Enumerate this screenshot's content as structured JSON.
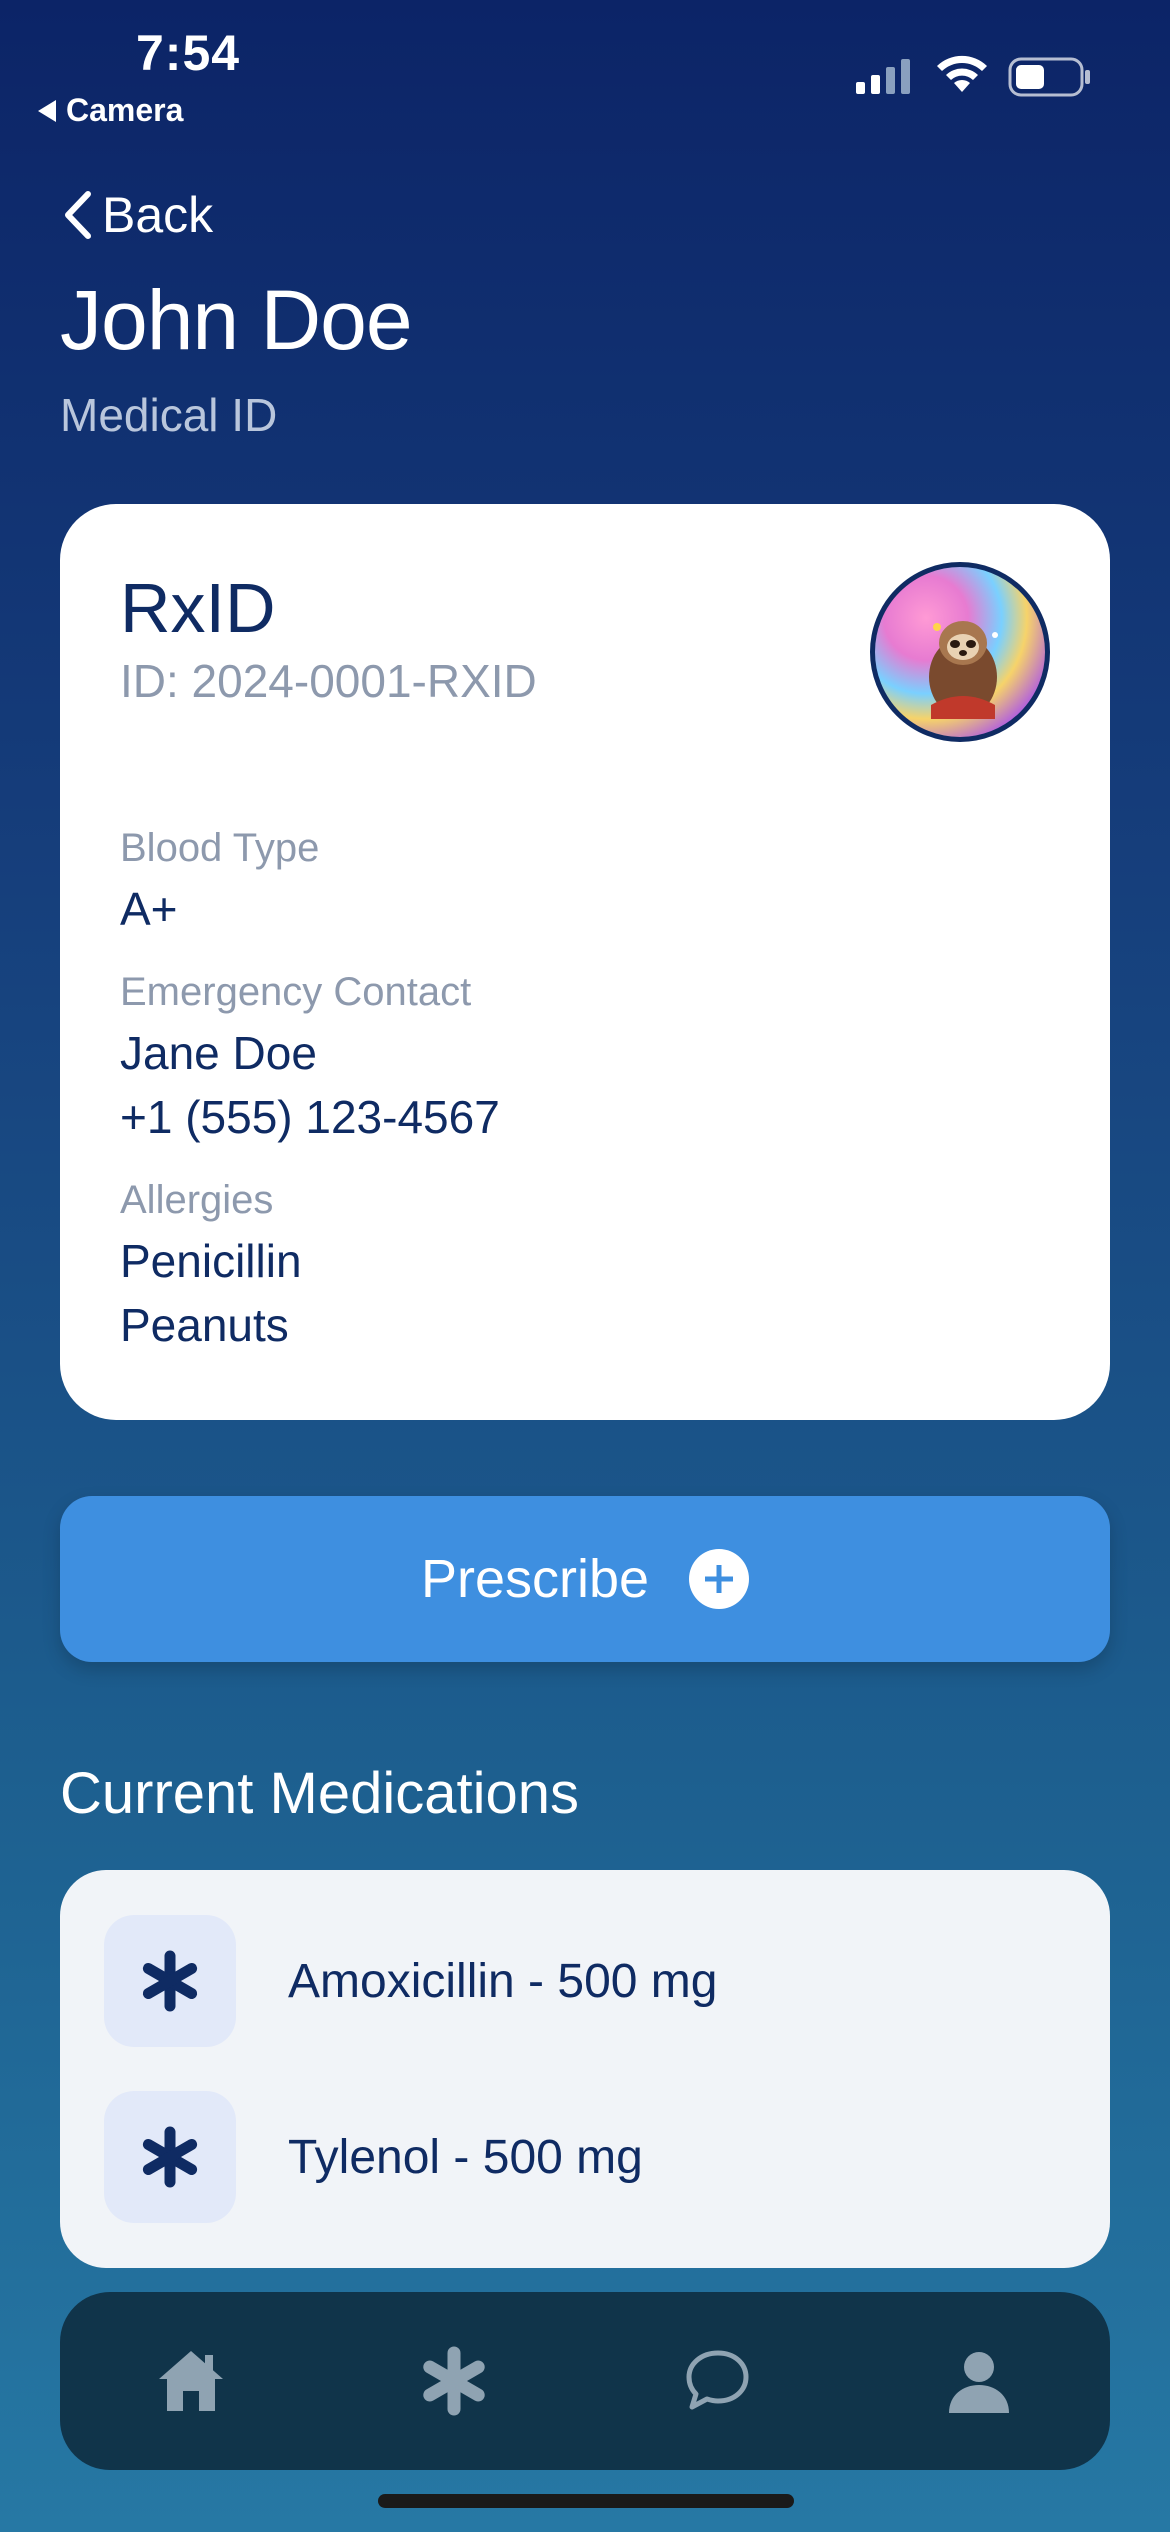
{
  "status_bar": {
    "time": "7:54",
    "back_app_label": "Camera"
  },
  "nav": {
    "back_label": "Back"
  },
  "header": {
    "name": "John Doe",
    "subtitle": "Medical ID"
  },
  "card": {
    "brand": "RxID",
    "id_line": "ID: 2024-0001-RXID",
    "blood_type_label": "Blood Type",
    "blood_type_value": "A+",
    "emergency_contact_label": "Emergency Contact",
    "emergency_contact_name": "Jane Doe",
    "emergency_contact_phone": "+1 (555) 123-4567",
    "allergies_label": "Allergies",
    "allergies": [
      "Penicillin",
      "Peanuts"
    ]
  },
  "prescribe_button": {
    "label": "Prescribe",
    "icon": "plus-circle-icon"
  },
  "medications": {
    "title": "Current Medications",
    "items": [
      {
        "label": "Amoxicillin - 500 mg",
        "icon": "asterisk-icon"
      },
      {
        "label": "Tylenol - 500 mg",
        "icon": "asterisk-icon"
      }
    ]
  },
  "tab_bar": {
    "tabs": [
      {
        "icon": "home-icon"
      },
      {
        "icon": "asterisk-icon"
      },
      {
        "icon": "chat-icon"
      },
      {
        "icon": "person-icon"
      }
    ]
  },
  "colors": {
    "background_top": "#0c2467",
    "background_bottom": "#2678a4",
    "primary_text": "#0f2b63",
    "muted_text": "#8d99ad",
    "accent_button": "#3e8fe0",
    "tab_bar": "#10344a",
    "tab_icon": "#8fa3b2"
  }
}
